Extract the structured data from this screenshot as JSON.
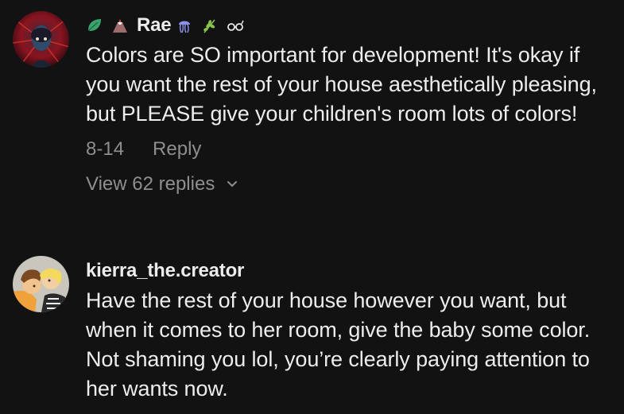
{
  "comments": [
    {
      "username": "Rae",
      "name_prefix_icons": [
        "leaf-icon",
        "volcano-icon"
      ],
      "name_suffix_icons": [
        "jellyfish-icon",
        "herb-icon",
        "glasses-icon"
      ],
      "text": "Colors are SO important for development! It's okay if you want the rest of your house aesthetically pleasing, but PLEASE give your children's room lots of colors!",
      "date": "8-14",
      "reply_label": "Reply",
      "view_replies_label": "View 62 replies"
    },
    {
      "username": "kierra_the.creator",
      "text": "Have the rest of your house however you want, but when it comes to her room, give the baby some color. Not shaming you lol, you’re clearly paying attention to her wants now."
    }
  ],
  "colors": {
    "background": "#121212",
    "text": "#ededed",
    "secondary": "#8e8e8e"
  }
}
